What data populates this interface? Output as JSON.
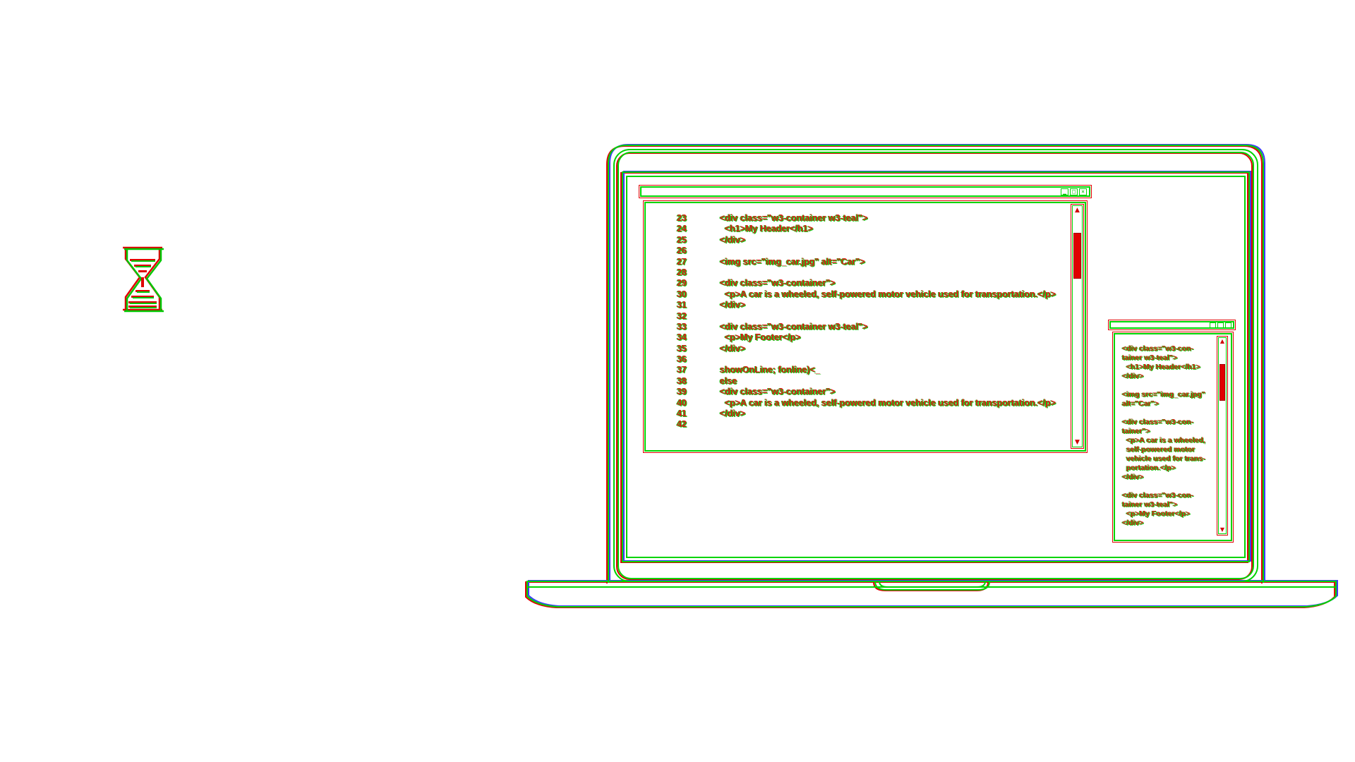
{
  "colors": {
    "outline_green": "#00d400",
    "outline_red": "#e00000",
    "outline_blue": "#3c3cff",
    "background": "#ffffff"
  },
  "icons": {
    "loading": "hourglass-icon",
    "window_minimize": "minimize-icon",
    "window_maximize": "maximize-icon",
    "window_close": "close-icon",
    "scroll_up": "chevron-up-icon",
    "scroll_down": "chevron-down-icon"
  },
  "main_editor": {
    "lines": [
      {
        "number": "23",
        "text": "<div class=\"w3-container w3-teal\">"
      },
      {
        "number": "24",
        "text": "  <h1>My Header</h1>"
      },
      {
        "number": "25",
        "text": "</div>"
      },
      {
        "number": "26",
        "text": ""
      },
      {
        "number": "27",
        "text": "<img src=\"img_car.jpg\" alt=\"Car\">"
      },
      {
        "number": "28",
        "text": ""
      },
      {
        "number": "29",
        "text": "<div class=\"w3-container\">"
      },
      {
        "number": "30",
        "text": "  <p>A car is a wheeled, self-powered motor vehicle used for transportation.</p>"
      },
      {
        "number": "31",
        "text": "</div>"
      },
      {
        "number": "32",
        "text": ""
      },
      {
        "number": "33",
        "text": "<div class=\"w3-container w3-teal\">"
      },
      {
        "number": "34",
        "text": "  <p>My Footer</p>"
      },
      {
        "number": "35",
        "text": "</div>"
      },
      {
        "number": "36",
        "text": ""
      },
      {
        "number": "37",
        "text": "showOnLine; fonline)<_"
      },
      {
        "number": "38",
        "text": "else"
      },
      {
        "number": "39",
        "text": "<div class=\"w3-container\">"
      },
      {
        "number": "40",
        "text": "  <p>A car is a wheeled, self-powered motor vehicle used for transportation.</p>"
      },
      {
        "number": "41",
        "text": "</div>"
      },
      {
        "number": "42",
        "text": ""
      }
    ],
    "scroll_position": 0.1
  },
  "side_panel": {
    "lines": [
      "<div class=\"w3-con-",
      "tainer w3-teal\">",
      "  <h1>My Header</h1>",
      "</div>",
      "",
      "<img src=\"img_car.jpg\"",
      "alt=\"Car\">",
      "",
      "<div class=\"w3-con-",
      "tainer\">",
      "  <p>A car is a wheeled,",
      "  self-powered motor",
      "  vehicle used for trans-",
      "  portation.</p>",
      "</div>",
      "",
      "<div class=\"w3-con-",
      "tainer w3-teal\">",
      "  <p>My Footer</p>",
      "</div>"
    ],
    "scroll_position": 0.12
  }
}
